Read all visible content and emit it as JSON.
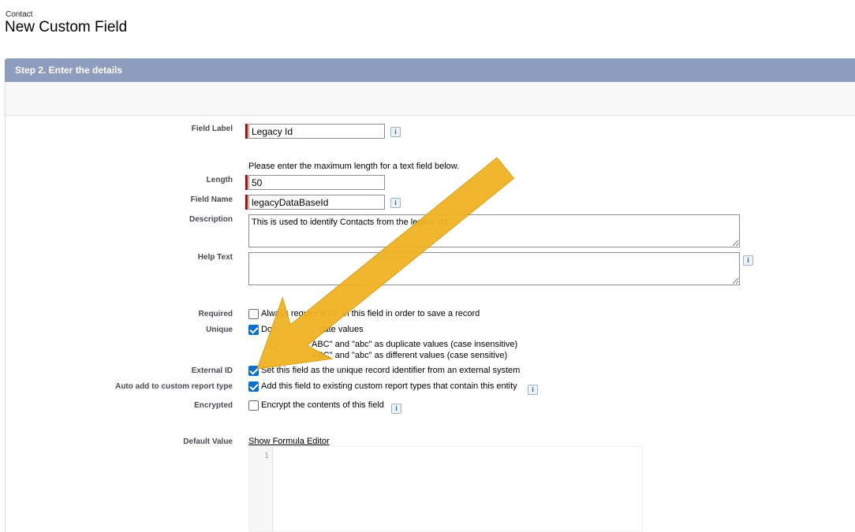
{
  "page": {
    "object_name": "Contact",
    "title": "New Custom Field"
  },
  "section": {
    "header": "Step 2. Enter the details"
  },
  "fields": {
    "field_label": {
      "label": "Field Label",
      "value": "Legacy Id"
    },
    "length_hint": "Please enter the maximum length for a text field below.",
    "length": {
      "label": "Length",
      "value": "50"
    },
    "field_name": {
      "label": "Field Name",
      "value": "legacyDataBaseId"
    },
    "description": {
      "label": "Description",
      "value": "This is used to identify Contacts from the legacy da"
    },
    "help_text": {
      "label": "Help Text",
      "value": ""
    },
    "required": {
      "label": "Required",
      "checkbox_text": "Always require a va",
      "checkbox_text_tail": "in this field in order to save a record",
      "checked": false
    },
    "unique": {
      "label": "Unique",
      "checkbox_text": "Do n",
      "checkbox_text_tail": "cate values",
      "checked": true,
      "option_insensitive": "ABC\" and \"abc\" as duplicate values (case insensitive)",
      "option_sensitive": "ABC\" and \"abc\" as different values (case sensitive)"
    },
    "external_id": {
      "label": "External ID",
      "checkbox_text": "Set this field as the unique record identifier from an external system",
      "checked": true
    },
    "auto_add": {
      "label": "Auto add to custom report type",
      "checkbox_text": "Add this field to existing custom report types that contain this entity",
      "checked": true
    },
    "encrypted": {
      "label": "Encrypted",
      "checkbox_text": "Encrypt the contents of this field",
      "checked": false
    },
    "default_value": {
      "label": "Default Value",
      "link": "Show Formula Editor",
      "line_number": "1"
    }
  },
  "info_icon_glyph": "i",
  "icons": {
    "info": "info-icon",
    "annotation": "yellow-arrow"
  },
  "colors": {
    "header_bg": "#8e9dbd",
    "required_marker": "#c00000",
    "checkbox_checked": "#0b6fd0",
    "annotation_arrow": "#f0b323"
  }
}
